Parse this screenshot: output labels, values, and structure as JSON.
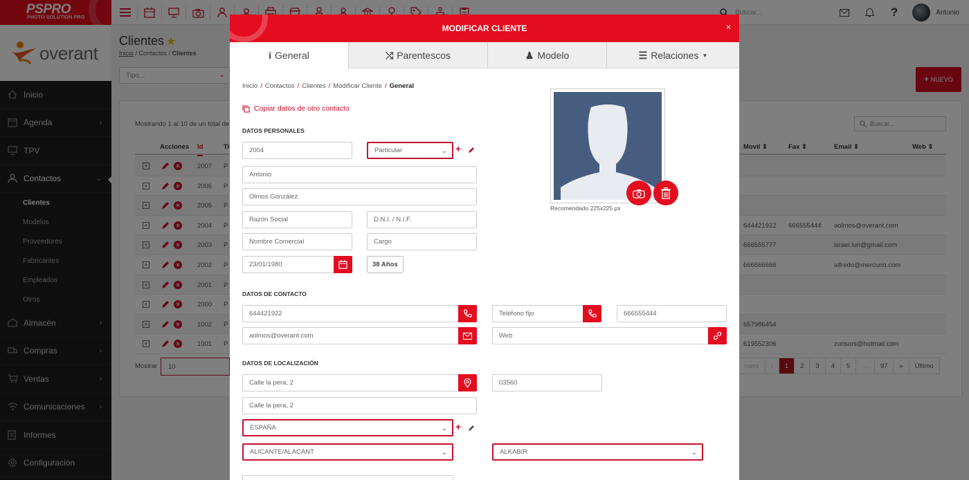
{
  "brand": {
    "name": "PSPRO",
    "sub": "PHOTO SOLUTION PRO"
  },
  "topbar": {
    "search_placeholder": "Buscar...",
    "help": "?",
    "user": "Antonio"
  },
  "sidebar": {
    "logo": "overant",
    "items": [
      {
        "label": "Inicio",
        "icon": "home-icon"
      },
      {
        "label": "Agenda",
        "icon": "calendar-icon"
      },
      {
        "label": "TPV",
        "icon": "monitor-icon"
      },
      {
        "label": "Contactos",
        "icon": "user-icon"
      },
      {
        "label": "Almacén",
        "icon": "warehouse-icon"
      },
      {
        "label": "Compras",
        "icon": "truck-icon"
      },
      {
        "label": "Ventas",
        "icon": "cart-icon"
      },
      {
        "label": "Comunicaciones",
        "icon": "wifi-icon"
      },
      {
        "label": "Informes",
        "icon": "document-icon"
      },
      {
        "label": "Configuración",
        "icon": "gear-icon"
      }
    ],
    "sub_items": [
      "Clientes",
      "Modelos",
      "Proveedores",
      "Fabricantes",
      "Empleados",
      "Otros"
    ]
  },
  "page": {
    "title": "Clientes",
    "breadcrumb": [
      "Inicio",
      "Contactos",
      "Clientes"
    ],
    "tipo_placeholder": "Tipo...",
    "nuevo_label": "NUEVO",
    "showing": "Mostrando 1 al 10 de un total de",
    "search_placeholder": "Buscar...",
    "table_headers": {
      "acciones": "Acciones",
      "id": "Id",
      "ti": "Ti",
      "movil": "Movil",
      "fax": "Fax",
      "email": "Email",
      "web": "Web"
    },
    "rows": [
      {
        "id": "2007",
        "t": "P",
        "movil": "",
        "fax": "",
        "email": ""
      },
      {
        "id": "2006",
        "t": "P",
        "movil": "",
        "fax": "",
        "email": ""
      },
      {
        "id": "2005",
        "t": "P",
        "movil": "",
        "fax": "",
        "email": ""
      },
      {
        "id": "2004",
        "t": "P",
        "movil": "644421922",
        "fax": "666555444",
        "email": "aolmos@overant.com"
      },
      {
        "id": "2003",
        "t": "P",
        "movil": "666555777",
        "fax": "",
        "email": "israel.luri@gmail.com"
      },
      {
        "id": "2002",
        "t": "P",
        "movil": "666666666",
        "fax": "",
        "email": "alfredo@mercurio.com"
      },
      {
        "id": "2001",
        "t": "P",
        "movil": "",
        "fax": "",
        "email": ""
      },
      {
        "id": "2000",
        "t": "P",
        "movil": "",
        "fax": "",
        "email": ""
      },
      {
        "id": "1002",
        "t": "P",
        "movil": "657986454",
        "fax": "",
        "email": ""
      },
      {
        "id": "1001",
        "t": "P",
        "movil": "619552306",
        "fax": "",
        "email": "zurisoni@hotmail.com"
      }
    ],
    "show_label": "Mostrar",
    "page_size": "10",
    "pager": [
      "mero",
      "‹",
      "1",
      "2",
      "3",
      "4",
      "5",
      "…",
      "97",
      "»",
      "Último"
    ]
  },
  "modal": {
    "title": "MODIFICAR CLIENTE",
    "close": "×",
    "tabs": [
      {
        "label": "General",
        "glyph": "i"
      },
      {
        "label": "Parentescos",
        "glyph": "⤮"
      },
      {
        "label": "Modelo",
        "glyph": "♟"
      },
      {
        "label": "Relaciones",
        "glyph": "☰"
      }
    ],
    "breadcrumb": [
      "Inicio",
      "Contactos",
      "Clientes",
      "Modificar Cliente",
      "General"
    ],
    "copy_link": "Copiar datos de otro contacto",
    "sections": {
      "personal": "DATOS PERSONALES",
      "contact": "DATOS DE CONTACTO",
      "location": "DATOS DE LOCALIZACIÓN"
    },
    "fields": {
      "code": "2004",
      "type": "Particular",
      "first_name": "Antonio",
      "last_name": "Olmos González",
      "company_ph": "Razón Social",
      "dni_ph": "D.N.I. / N.I.F.",
      "trade_name_ph": "Nombre Comercial",
      "position_ph": "Cargo",
      "birthdate": "23/01/1980",
      "age": "38 Años",
      "mobile": "644421922",
      "landline_ph": "Teléfono fijo",
      "fax": "666555444",
      "email": "aolmos@overant.com",
      "web_ph": "Web",
      "address1": "Calle la pera, 2",
      "postal_code": "03560",
      "address2": "Calle la pera, 2",
      "country": "ESPAÑA",
      "province": "ALICANTE/ALACANT",
      "city": "ALKABIR"
    },
    "photo_note": "Recomendado 225x225 px"
  },
  "colors": {
    "brand_red": "#e30d1f",
    "dark_red": "#b1101f",
    "sidebar": "#1f1f1f",
    "avatar_bg": "#465d7f"
  }
}
